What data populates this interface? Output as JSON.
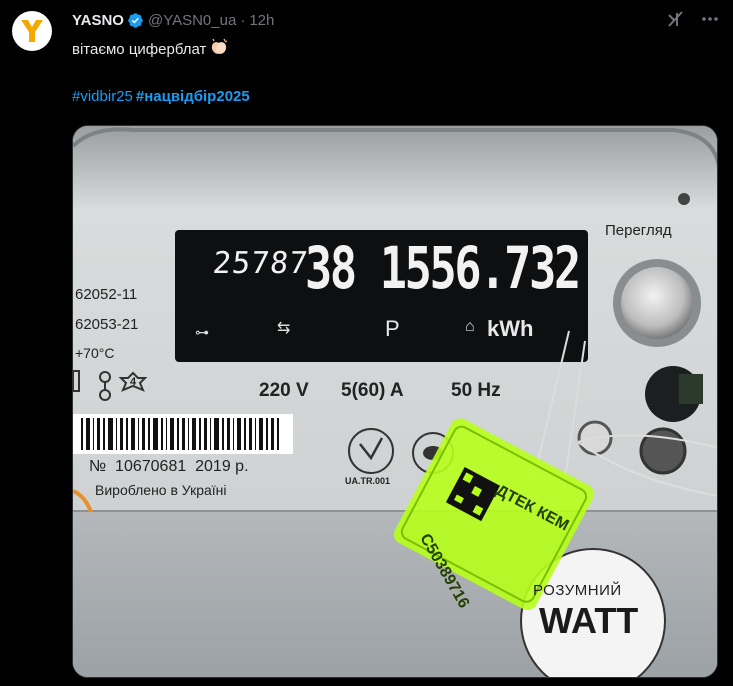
{
  "tweet": {
    "author_name": "YASNO",
    "handle": "@YASN0_ua",
    "separator": "·",
    "time": "12h",
    "text": "вітаємо циферблат",
    "hashtags": [
      "#vidbir25",
      "#нацвідбір2025"
    ]
  },
  "icons": {
    "avatar": "yasno-logo",
    "verified": "verified-badge-icon",
    "emoji": "clapping-hands-emoji",
    "grok": "grok-icon",
    "more": "more-icon"
  },
  "meter": {
    "display_small": "25787",
    "display_big": "38 1556.732",
    "indicator_p": "P",
    "indicator_kwh": "kWh",
    "view_label": "Перегляд",
    "left_code_1": "62052-11",
    "left_code_2": "62053-21",
    "temperature": "+70°C",
    "accuracy_class": "4",
    "rating_voltage": "220 V",
    "rating_current": "5(60) A",
    "rating_freq": "50 Hz",
    "serial": "№  10670681  2019 р.",
    "made_in": "Вироблено в Україні",
    "cert_mark": "UA.TR.001",
    "seal_text": "ДТЕК КЕМ",
    "seal_number": "С50389716",
    "brand_small": "РОЗУМНИЙ",
    "brand_big": "WATT"
  },
  "colors": {
    "background": "#000000",
    "text": "#e7e9ea",
    "muted": "#71767b",
    "link": "#1d9bf0",
    "verified": "#1d9bf0",
    "avatar_mark": "#f5a800",
    "seal": "#b6ff1a"
  }
}
